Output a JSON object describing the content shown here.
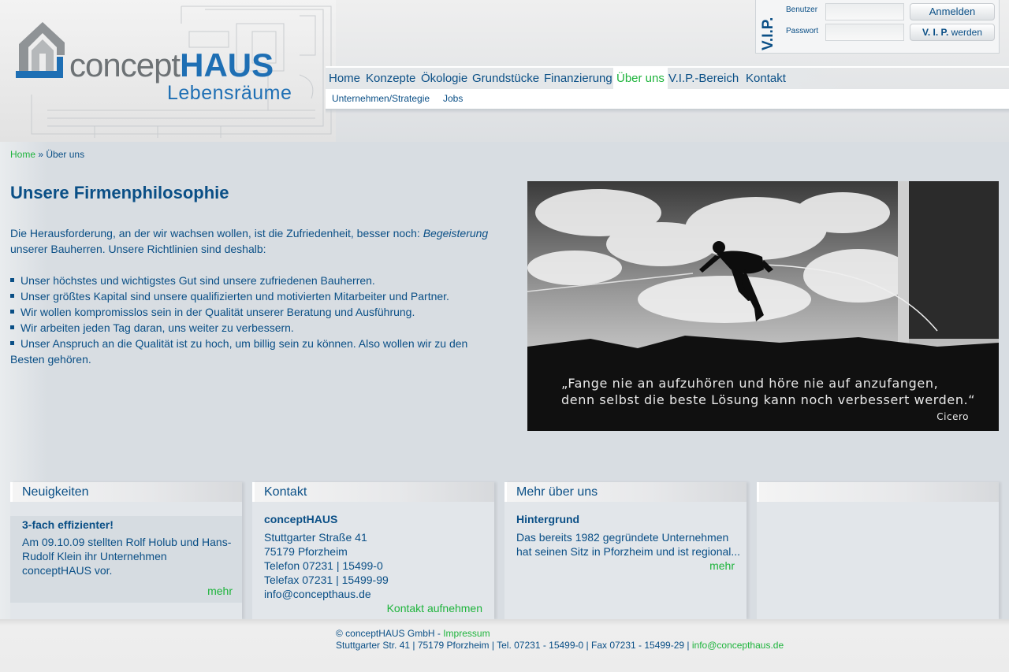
{
  "header": {
    "logo": {
      "word1": "concept",
      "word2": "HAUS",
      "tagline": "Lebensräume"
    },
    "vip": {
      "label": "V.I.P.",
      "user_label": "Benutzer",
      "password_label": "Passwort",
      "user_value": "",
      "password_value": "",
      "login_button": "Anmelden",
      "register_prefix": "V. I. P.",
      "register_suffix": "werden"
    },
    "nav": [
      "Home",
      "Konzepte",
      "Ökologie",
      "Grundstücke",
      "Finanzierung",
      "Über uns",
      "V.I.P.-Bereich",
      "Kontakt"
    ],
    "active_nav": "Über uns",
    "subnav": [
      "Unternehmen/Strategie",
      "Jobs"
    ]
  },
  "breadcrumb": {
    "home": "Home",
    "separator": "»",
    "current": "Über uns"
  },
  "main": {
    "title": "Unsere Firmenphilosophie",
    "intro_before": "Die Herausforderung, an der wir wachsen wollen, ist die Zufriedenheit, besser noch: ",
    "intro_emphasis": "Begeisterung",
    "intro_after": " unserer Bauherren. Unsere Richtlinien sind deshalb:",
    "principles": [
      "Unser höchstes und wichtigstes Gut sind unsere zufriedenen Bauherren.",
      "Unser größtes Kapital sind unsere qualifizierten und motivierten Mitarbeiter und Partner.",
      "Wir wollen kompromisslos sein in der Qualität unserer Beratung und Ausführung.",
      "Wir arbeiten jeden Tag daran, uns weiter zu verbessern.",
      "Unser Anspruch an die Qualität ist zu hoch, um billig sein zu können. Also wollen wir zu den Besten gehören."
    ],
    "photo": {
      "quote_line1": "„Fange nie an aufzuhören und höre nie auf anzufangen,",
      "quote_line2": "denn selbst die beste Lösung kann noch verbessert werden.“",
      "author": "Cicero"
    }
  },
  "boxes": {
    "news": {
      "title": "Neuigkeiten",
      "headline": "3-fach effizienter!",
      "text": "Am 09.10.09 stellten Rolf Holub und Hans-Rudolf Klein ihr Unternehmen conceptHAUS vor.",
      "more": "mehr"
    },
    "contact": {
      "title": "Kontakt",
      "company": "conceptHAUS",
      "street": "Stuttgarter Straße 41",
      "city": "75179 Pforzheim",
      "phone": "Telefon 07231 | 15499-0",
      "fax": "Telefax 07231 | 15499-99",
      "email": "info@concepthaus.de",
      "cta": "Kontakt aufnehmen"
    },
    "about": {
      "title": "Mehr über uns",
      "headline": "Hintergrund",
      "text": "Das bereits 1982 gegründete Unternehmen hat seinen Sitz in Pforzheim und ist regional...",
      "more": "mehr"
    }
  },
  "footer": {
    "copyright": "© conceptHAUS GmbH - ",
    "impressum": "Impressum",
    "address": "Stuttgarter Str. 41 | 75179 Pforzheim | Tel. 07231 - 15499-0 | Fax 07231 - 15499-29 | ",
    "email": "info@concepthaus.de"
  },
  "colors": {
    "primary": "#0a4f86",
    "accent_green": "#1eb43c",
    "logo_blue": "#1e6fb4",
    "background": "#d8dde2"
  }
}
